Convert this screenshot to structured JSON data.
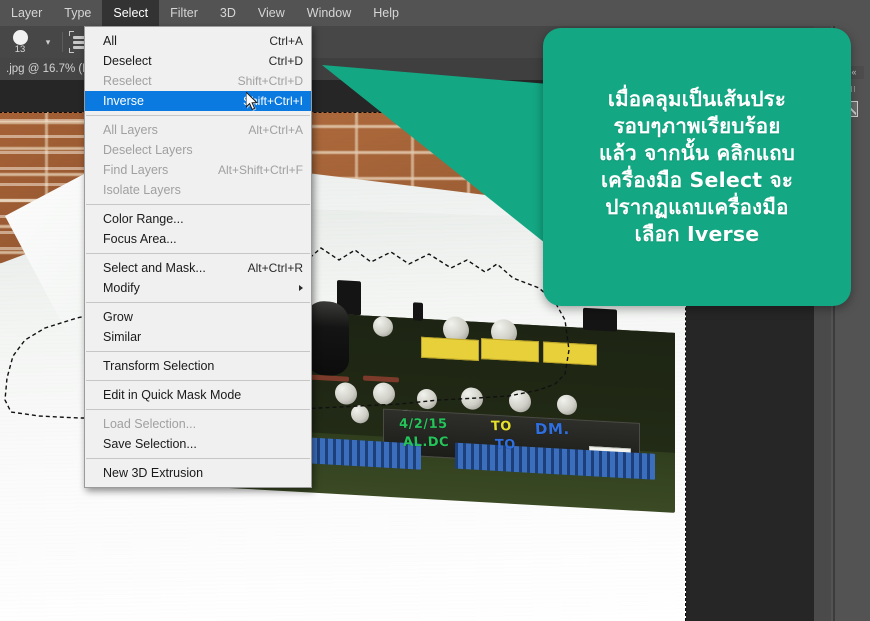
{
  "app": {
    "menubar": [
      {
        "label": "Layer",
        "active": false
      },
      {
        "label": "Type",
        "active": false
      },
      {
        "label": "Select",
        "active": true
      },
      {
        "label": "Filter",
        "active": false
      },
      {
        "label": "3D",
        "active": false
      },
      {
        "label": "View",
        "active": false
      },
      {
        "label": "Window",
        "active": false
      },
      {
        "label": "Help",
        "active": false
      }
    ]
  },
  "options_bar": {
    "brush_size": "13",
    "brush_dropdown_icon": "chevron-down-icon",
    "layers_stack_icon": "select-subject-icon"
  },
  "document_tab": {
    "title": ".jpg @ 16.7% (R"
  },
  "select_menu": {
    "items": [
      {
        "label": "All",
        "shortcut": "Ctrl+A",
        "disabled": false,
        "selected": false,
        "submenu": false
      },
      {
        "label": "Deselect",
        "shortcut": "Ctrl+D",
        "disabled": false,
        "selected": false,
        "submenu": false
      },
      {
        "label": "Reselect",
        "shortcut": "Shift+Ctrl+D",
        "disabled": true,
        "selected": false,
        "submenu": false
      },
      {
        "label": "Inverse",
        "shortcut": "Shift+Ctrl+I",
        "disabled": false,
        "selected": true,
        "submenu": false
      },
      {
        "separator": true
      },
      {
        "label": "All Layers",
        "shortcut": "Alt+Ctrl+A",
        "disabled": true,
        "selected": false,
        "submenu": false
      },
      {
        "label": "Deselect Layers",
        "shortcut": "",
        "disabled": true,
        "selected": false,
        "submenu": false
      },
      {
        "label": "Find Layers",
        "shortcut": "Alt+Shift+Ctrl+F",
        "disabled": true,
        "selected": false,
        "submenu": false
      },
      {
        "label": "Isolate Layers",
        "shortcut": "",
        "disabled": true,
        "selected": false,
        "submenu": false
      },
      {
        "separator": true
      },
      {
        "label": "Color Range...",
        "shortcut": "",
        "disabled": false,
        "selected": false,
        "submenu": false
      },
      {
        "label": "Focus Area...",
        "shortcut": "",
        "disabled": false,
        "selected": false,
        "submenu": false
      },
      {
        "separator": true
      },
      {
        "label": "Select and Mask...",
        "shortcut": "Alt+Ctrl+R",
        "disabled": false,
        "selected": false,
        "submenu": false
      },
      {
        "label": "Modify",
        "shortcut": "",
        "disabled": false,
        "selected": false,
        "submenu": true
      },
      {
        "separator": true
      },
      {
        "label": "Grow",
        "shortcut": "",
        "disabled": false,
        "selected": false,
        "submenu": false
      },
      {
        "label": "Similar",
        "shortcut": "",
        "disabled": false,
        "selected": false,
        "submenu": false
      },
      {
        "separator": true
      },
      {
        "label": "Transform Selection",
        "shortcut": "",
        "disabled": false,
        "selected": false,
        "submenu": false
      },
      {
        "separator": true
      },
      {
        "label": "Edit in Quick Mask Mode",
        "shortcut": "",
        "disabled": false,
        "selected": false,
        "submenu": false
      },
      {
        "separator": true
      },
      {
        "label": "Load Selection...",
        "shortcut": "",
        "disabled": true,
        "selected": false,
        "submenu": false
      },
      {
        "label": "Save Selection...",
        "shortcut": "",
        "disabled": false,
        "selected": false,
        "submenu": false
      },
      {
        "separator": true
      },
      {
        "label": "New 3D Extrusion",
        "shortcut": "",
        "disabled": false,
        "selected": false,
        "submenu": false
      }
    ]
  },
  "callout": {
    "text": "เมื่อคลุมเป็นเส้นประ\nรอบๆภาพเรียบร้อย\nแล้ว จากนั้น คลิกแถบ\nเครื่องมือ Select จะ\nปรากฏแถบเครื่องมือ\nเลือก Iverse",
    "background_color": "#13a883",
    "text_color": "#ffffff"
  },
  "canvas": {
    "photo_description": "circuit-board-photo",
    "board_marks": [
      {
        "text": "4/2/15",
        "color": "#25c45a"
      },
      {
        "text": "AL.DC",
        "color": "#25c45a"
      },
      {
        "text": "TO",
        "color": "#e6e22c"
      },
      {
        "text": "DM.",
        "color": "#2f6fe0"
      },
      {
        "text": "TO",
        "color": "#2f6fe0"
      }
    ]
  },
  "right_panel": {
    "collapse_icon": "«",
    "panel_icon": "mask-panel-icon"
  },
  "cursor": {
    "icon": "mouse-pointer-icon"
  },
  "colors": {
    "menu_bar_bg": "#535353",
    "options_bar_bg": "#474747",
    "menu_selected": "#0a7ae0",
    "workspace_bg": "#262626",
    "callout_green": "#13a883"
  }
}
